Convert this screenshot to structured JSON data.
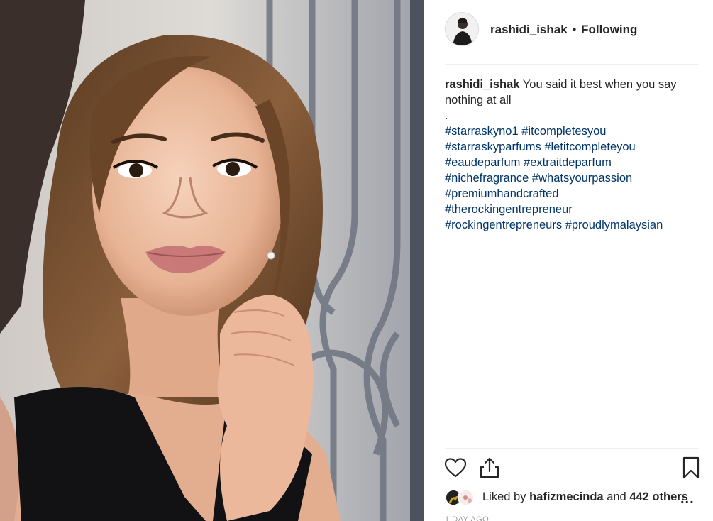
{
  "post": {
    "author": "rashidi_ishak",
    "separator": "•",
    "follow_status": "Following",
    "caption_text": "You said it best when you say",
    "caption_text_2": "nothing at all",
    "caption_dot": ".",
    "hashtag_lines": [
      [
        "#starraskyno1",
        "#itcompletesyou"
      ],
      [
        "#starraskyparfums",
        "#letitcompleteyou"
      ],
      [
        "#eaudeparfum",
        "#extraitdeparfum"
      ],
      [
        "#nichefragrance",
        "#whatsyourpassion"
      ],
      [
        "#premiumhandcrafted"
      ],
      [
        "#therockingentrepreneur"
      ],
      [
        "#rockingentrepreneurs",
        "#proudlymalaysian"
      ]
    ],
    "likes_prefix": "Liked by",
    "liked_by": "hafizmecinda",
    "likes_and": "and",
    "likes_others": "442 others",
    "more_label": "...",
    "timestamp": "1 DAY AGO"
  },
  "icons": {
    "like": "heart-icon",
    "share": "share-icon",
    "save": "bookmark-icon",
    "more": "more-icon"
  },
  "colors": {
    "hashtag": "#003569",
    "text": "#262626",
    "muted": "#999999",
    "divider": "#efefef"
  }
}
